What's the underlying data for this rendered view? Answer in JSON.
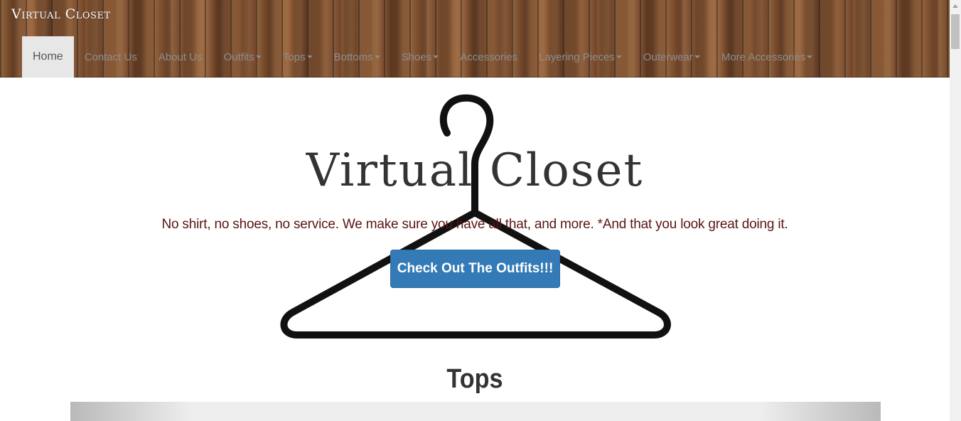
{
  "navbar": {
    "brand": "Virtual Closet",
    "items": [
      {
        "label": "Home",
        "active": true,
        "dropdown": false
      },
      {
        "label": "Contact Us",
        "active": false,
        "dropdown": false
      },
      {
        "label": "About Us",
        "active": false,
        "dropdown": false
      },
      {
        "label": "Outfits",
        "active": false,
        "dropdown": true
      },
      {
        "label": "Tops",
        "active": false,
        "dropdown": true
      },
      {
        "label": "Bottoms",
        "active": false,
        "dropdown": true
      },
      {
        "label": "Shoes",
        "active": false,
        "dropdown": true
      },
      {
        "label": "Accessories",
        "active": false,
        "dropdown": false
      },
      {
        "label": "Layering Pieces",
        "active": false,
        "dropdown": true
      },
      {
        "label": "Outerwear",
        "active": false,
        "dropdown": true
      },
      {
        "label": "More Accessories",
        "active": false,
        "dropdown": true
      }
    ]
  },
  "hero": {
    "title": "Virtual Closet",
    "tagline": "No shirt, no shoes, no service. We make sure you have all that, and more. *And that you look great doing it.",
    "cta_label": "Check Out The Outfits!!!",
    "image_icon": "clothes-hanger-icon"
  },
  "section": {
    "heading": "Tops"
  },
  "colors": {
    "cta_background": "#337ab7",
    "tagline_text": "#5a1414",
    "active_nav_background": "#e7e7e7"
  }
}
